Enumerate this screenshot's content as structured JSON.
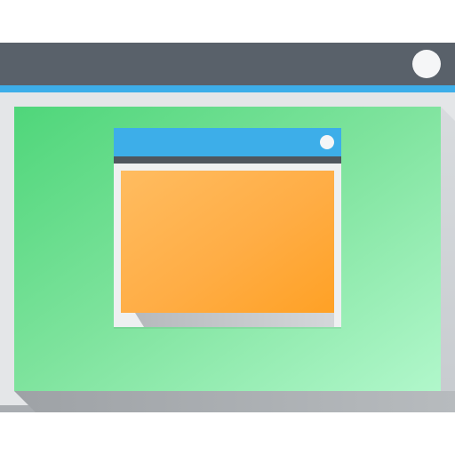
{
  "icon": {
    "semantic_name": "window-icon",
    "colors": {
      "outer_titlebar": "#59616a",
      "outer_accent": "#3daee9",
      "outer_frame": "#e4e6e8",
      "outer_client_start": "#4fd67a",
      "outer_client_end": "#b1f7cb",
      "inner_titlebar": "#3daee9",
      "inner_frame": "#eef0f1",
      "inner_client_start": "#ffbc60",
      "inner_client_end": "#ffa125",
      "close_button": "#f5f6f7"
    },
    "outer_window": {
      "close_icon": "close-button-icon"
    },
    "inner_window": {
      "close_icon": "close-button-icon"
    }
  }
}
